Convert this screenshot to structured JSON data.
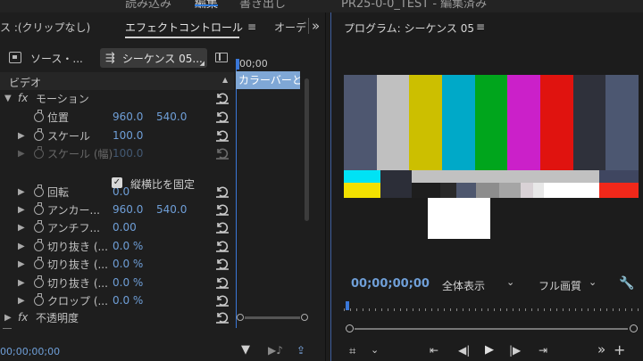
{
  "workspace_tabs": [
    "読み込み",
    "編集",
    "書き出し"
  ],
  "window_title": "PR25-0-0_TEST - 編集済み",
  "effect_controls": {
    "tab_source": "ス :(クリップなし)",
    "tab_effect": "エフェクトコントロール",
    "tab_audio": "オーデ",
    "menu_glyph": "≡",
    "more_glyph": "»",
    "source_btn": "ソース・...",
    "sequence_btn": "シーケンス 05...",
    "timecode": "00;00",
    "clip_label": "カラーバーと",
    "video_header": "ビデオ",
    "fx_glyph": "fx",
    "motion": "モーション",
    "rows": [
      {
        "label": "位置",
        "v1": "960.0",
        "v2": "540.0"
      },
      {
        "label": "スケール",
        "v1": "100.0",
        "v2": ""
      },
      {
        "label": "スケール (幅)",
        "v1": "100.0",
        "v2": ""
      },
      {
        "label": "回転",
        "v1": "0.0",
        "v2": ""
      },
      {
        "label": "アンカー...",
        "v1": "960.0",
        "v2": "540.0"
      },
      {
        "label": "アンチフ...",
        "v1": "0.00",
        "v2": ""
      },
      {
        "label": "切り抜き (...",
        "v1": "0.0 %",
        "v2": ""
      },
      {
        "label": "切り抜き (...",
        "v1": "0.0 %",
        "v2": ""
      },
      {
        "label": "切り抜き (...",
        "v1": "0.0 %",
        "v2": ""
      },
      {
        "label": "クロップ (...",
        "v1": "0.0 %",
        "v2": ""
      }
    ],
    "uniform_scale": "縦横比を固定",
    "opacity": "不透明度",
    "bottom_timecode": "00;00;00;00"
  },
  "program": {
    "title": "プログラム: シーケンス 05",
    "menu_glyph": "≡",
    "timecode": "00;00;00;00",
    "zoom": "全体表示",
    "quality": "フル画質",
    "colors": {
      "bars": [
        "#4e5770",
        "#c0c0c0",
        "#ccbf00",
        "#00a9c8",
        "#00a51c",
        "#cb20c9",
        "#e0130f",
        "#2f313b",
        "#4c5771"
      ]
    }
  }
}
